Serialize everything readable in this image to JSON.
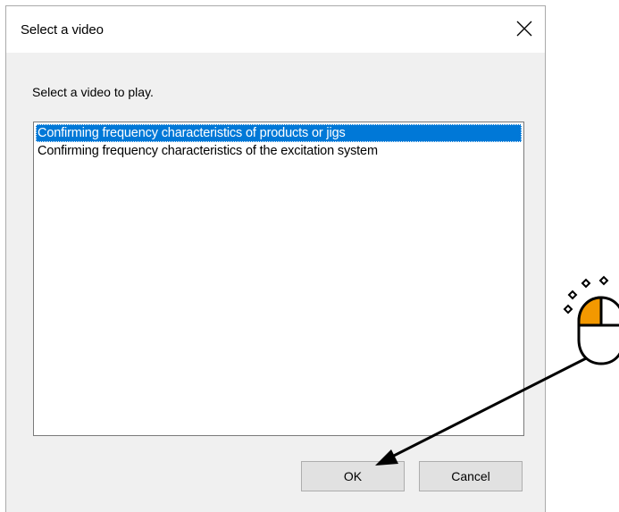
{
  "dialog": {
    "title": "Select a video",
    "close_icon": "close-icon",
    "prompt": "Select a video to play.",
    "videos": [
      {
        "label": "Confirming frequency characteristics of products or jigs",
        "selected": true
      },
      {
        "label": "Confirming frequency characteristics of the excitation system",
        "selected": false
      }
    ],
    "ok_label": "OK",
    "cancel_label": "Cancel"
  },
  "annotation": {
    "icon": "mouse-click-icon",
    "accent_color": "#f39800",
    "arrow_target": "ok-button"
  },
  "colors": {
    "selection": "#0078d7",
    "dialog_bg": "#f0f0f0",
    "button_bg": "#e1e1e1"
  }
}
